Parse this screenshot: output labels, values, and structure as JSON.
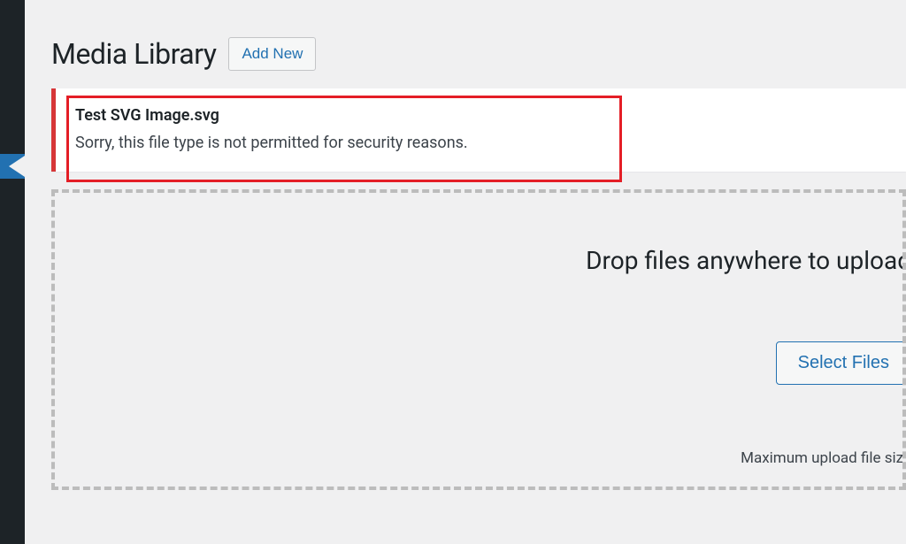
{
  "header": {
    "title": "Media Library",
    "add_new_label": "Add New"
  },
  "notice": {
    "filename": "Test SVG Image.svg",
    "message": "Sorry, this file type is not permitted for security reasons."
  },
  "dropzone": {
    "heading": "Drop files anywhere to upload",
    "select_label": "Select Files",
    "max_text": "Maximum upload file size"
  }
}
